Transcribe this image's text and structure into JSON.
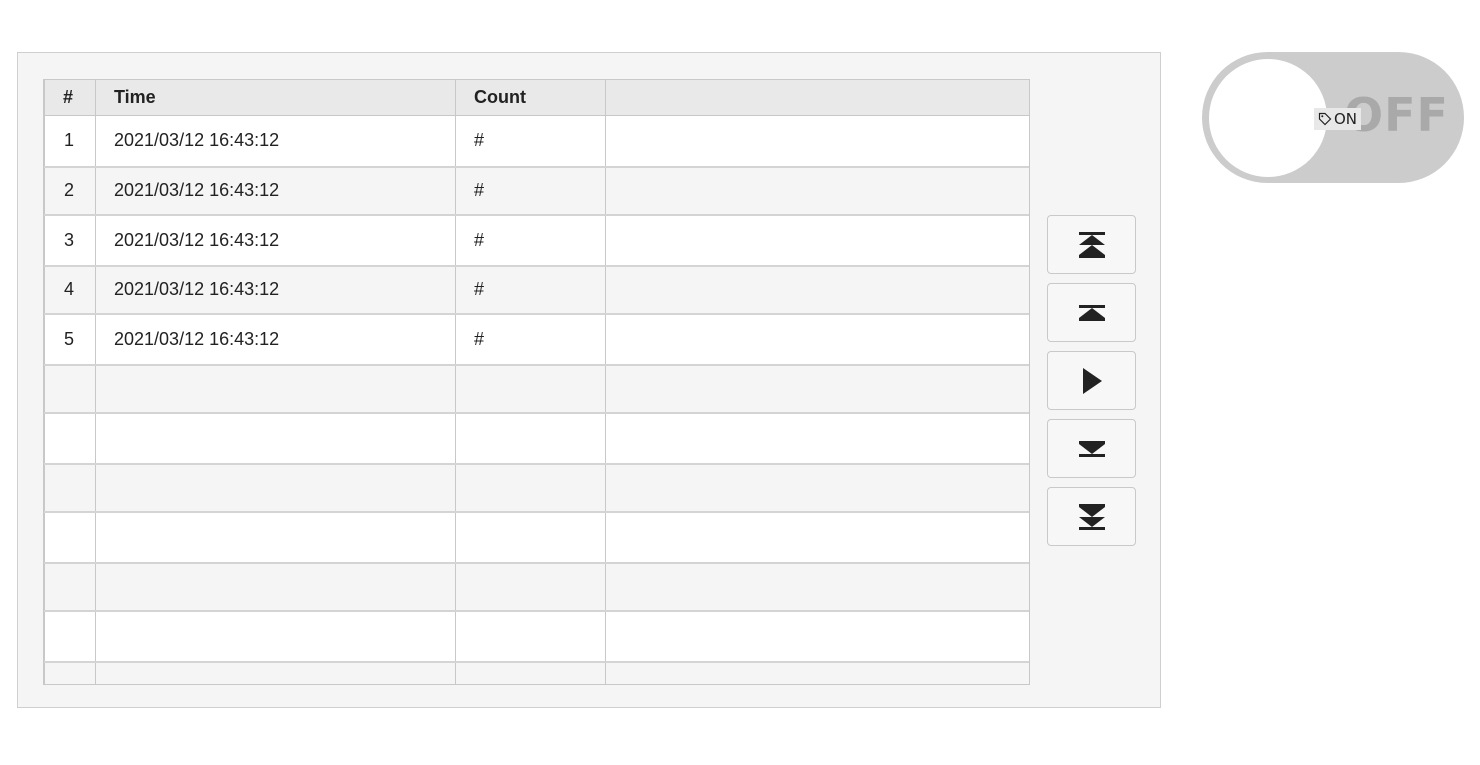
{
  "table": {
    "headers": [
      "#",
      "Time",
      "Count",
      ""
    ],
    "rows": [
      {
        "num": "1",
        "time": "2021/03/12 16:43:12",
        "count": "#",
        "extra": ""
      },
      {
        "num": "2",
        "time": "2021/03/12 16:43:12",
        "count": "#",
        "extra": ""
      },
      {
        "num": "3",
        "time": "2021/03/12 16:43:12",
        "count": "#",
        "extra": ""
      },
      {
        "num": "4",
        "time": "2021/03/12 16:43:12",
        "count": "#",
        "extra": ""
      },
      {
        "num": "5",
        "time": "2021/03/12 16:43:12",
        "count": "#",
        "extra": ""
      },
      {
        "num": "",
        "time": "",
        "count": "",
        "extra": ""
      },
      {
        "num": "",
        "time": "",
        "count": "",
        "extra": ""
      },
      {
        "num": "",
        "time": "",
        "count": "",
        "extra": ""
      },
      {
        "num": "",
        "time": "",
        "count": "",
        "extra": ""
      },
      {
        "num": "",
        "time": "",
        "count": "",
        "extra": ""
      },
      {
        "num": "",
        "time": "",
        "count": "",
        "extra": ""
      },
      {
        "num": "",
        "time": "",
        "count": "",
        "extra": ""
      }
    ]
  },
  "nav_buttons": [
    {
      "name": "first-page-button",
      "icon": "double-up-bar-icon"
    },
    {
      "name": "previous-page-button",
      "icon": "up-bar-icon"
    },
    {
      "name": "play-button",
      "icon": "play-icon"
    },
    {
      "name": "next-page-button",
      "icon": "down-bar-icon"
    },
    {
      "name": "last-page-button",
      "icon": "double-down-bar-icon"
    }
  ],
  "toggle": {
    "off_text": "OFF",
    "on_label": "ON",
    "on_label_icon": "tag-icon",
    "state": "off"
  },
  "colors": {
    "panel_bg": "#f5f5f5",
    "header_bg": "#e9e9e9",
    "toggle_track": "#cccccc",
    "icon": "#222222"
  }
}
